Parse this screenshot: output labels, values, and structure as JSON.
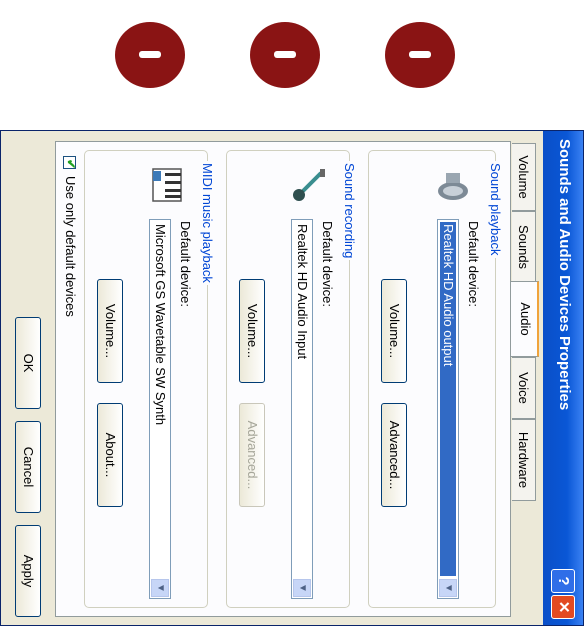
{
  "window": {
    "title": "Sounds and Audio Devices Properties",
    "help_label": "?",
    "close_label": "✕"
  },
  "tabs": [
    {
      "label": "Volume",
      "active": false
    },
    {
      "label": "Sounds",
      "active": false
    },
    {
      "label": "Audio",
      "active": true
    },
    {
      "label": "Voice",
      "active": false
    },
    {
      "label": "Hardware",
      "active": false
    }
  ],
  "playback": {
    "title": "Sound playback",
    "default_label": "Default device:",
    "device": "Realtek HD Audio output",
    "volume_label": "Volume...",
    "advanced_label": "Advanced..."
  },
  "recording": {
    "title": "Sound recording",
    "default_label": "Default device:",
    "device": "Realtek HD Audio Input",
    "volume_label": "Volume...",
    "advanced_label": "Advanced..."
  },
  "midi": {
    "title": "MIDI music playback",
    "default_label": "Default device:",
    "device": "Microsoft GS Wavetable SW Synth",
    "volume_label": "Volume...",
    "about_label": "About..."
  },
  "use_default_only": {
    "label": "Use only default devices",
    "checked": true
  },
  "footer": {
    "ok_label": "OK",
    "cancel_label": "Cancel",
    "apply_label": "Apply"
  },
  "colors": {
    "title_bar": "#0a57d6",
    "group_title": "#0046d5",
    "selection": "#316ac5",
    "dots": "#8a1414"
  },
  "icons": [
    "speaker-icon",
    "microphone-icon",
    "midi-keyboard-icon",
    "chevron-down-icon",
    "check-icon",
    "help-icon",
    "close-icon"
  ]
}
